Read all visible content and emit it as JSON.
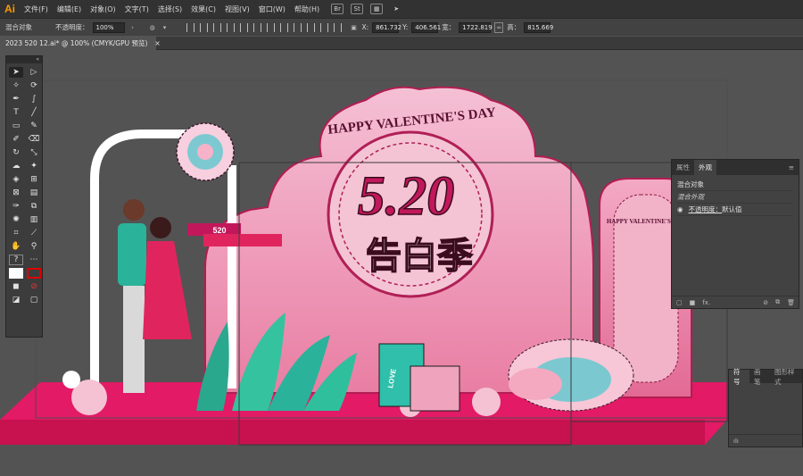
{
  "app": {
    "logo": "Ai"
  },
  "menu": [
    {
      "label": "文件(F)"
    },
    {
      "label": "编辑(E)"
    },
    {
      "label": "对象(O)"
    },
    {
      "label": "文字(T)"
    },
    {
      "label": "选择(S)"
    },
    {
      "label": "效果(C)"
    },
    {
      "label": "视图(V)"
    },
    {
      "label": "窗口(W)"
    },
    {
      "label": "帮助(H)"
    }
  ],
  "menu_icons": {
    "bridge": "Br",
    "stock": "St"
  },
  "control": {
    "object_type": "混合对象",
    "opacity_label": "不透明度：",
    "opacity_value": "100%",
    "x_label": "X:",
    "x_value": "861.732",
    "y_label": "Y:",
    "y_value": "406.561",
    "w_label": "宽：",
    "w_value": "1722.819",
    "h_label": "高：",
    "h_value": "815.669"
  },
  "document_tab": {
    "title": "2023 520 12.ai* @ 100% (CMYK/GPU 预览)",
    "close": "×"
  },
  "panel": {
    "tabs": [
      {
        "label": "属性"
      },
      {
        "label": "外观"
      }
    ],
    "object": "混合对象",
    "blend_appearance": "混合外观",
    "opacity_label": "不透明度：",
    "opacity_value": "默认值",
    "fx": "fx."
  },
  "panel2": {
    "tabs": [
      {
        "label": "符号"
      },
      {
        "label": "画笔"
      },
      {
        "label": "图形样式"
      }
    ]
  },
  "artwork": {
    "arch_text": "HAPPY VALENTINE'S DAY",
    "main_number": "5.20",
    "main_title": "告白季",
    "small_sign_text": "HAPPY VALENTINE'S DAY",
    "bag_text": "LOVE",
    "left_sign_top": "520",
    "colors": {
      "pink": "#f3a6c4",
      "deep_pink": "#d7336e",
      "floor": "#e8196a",
      "teal": "#2bbfa9"
    }
  }
}
